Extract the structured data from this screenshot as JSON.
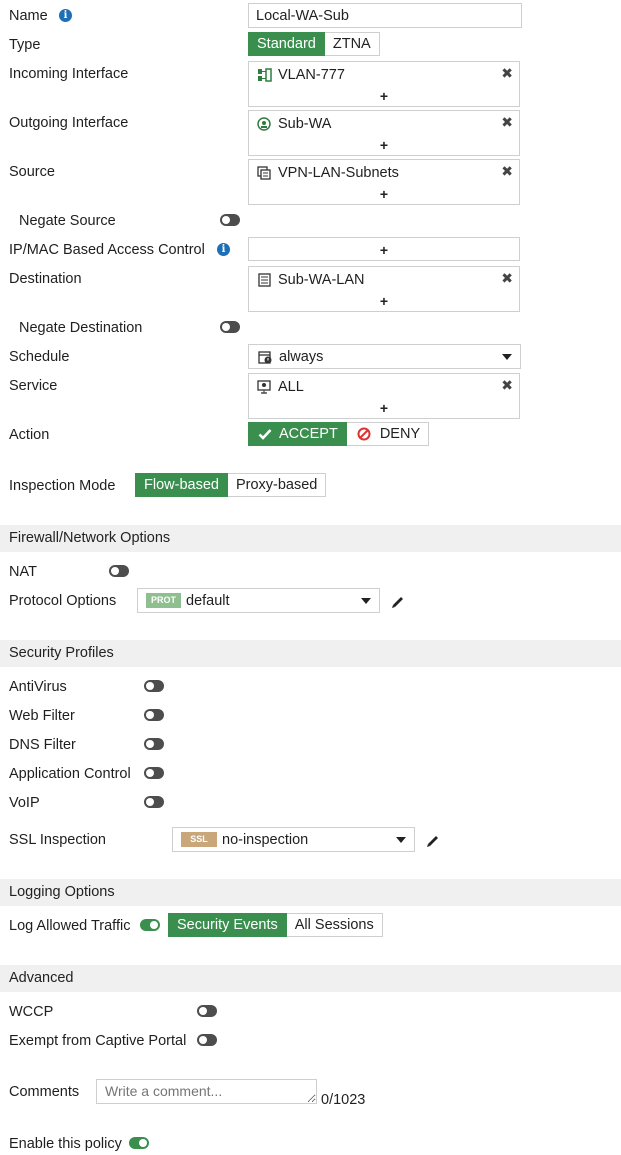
{
  "labels": {
    "name": "Name",
    "type": "Type",
    "incoming_interface": "Incoming Interface",
    "outgoing_interface": "Outgoing Interface",
    "source": "Source",
    "negate_source": "Negate Source",
    "ipmac": "IP/MAC Based Access Control",
    "destination": "Destination",
    "negate_destination": "Negate Destination",
    "schedule": "Schedule",
    "service": "Service",
    "action": "Action",
    "inspection_mode": "Inspection Mode"
  },
  "name_value": "Local-WA-Sub",
  "type_options": [
    "Standard",
    "ZTNA"
  ],
  "incoming_interface": "VLAN-777",
  "outgoing_interface": "Sub-WA",
  "source": "VPN-LAN-Subnets",
  "destination": "Sub-WA-LAN",
  "schedule": "always",
  "service": "ALL",
  "add_symbol": "+",
  "remove_symbol": "✖",
  "action_options": [
    "ACCEPT",
    "DENY"
  ],
  "inspection_options": [
    "Flow-based",
    "Proxy-based"
  ],
  "firewall": {
    "title": "Firewall/Network Options",
    "nat": "NAT",
    "protocol_options": "Protocol Options",
    "prot_tag": "PROT",
    "protocol_value": "default"
  },
  "security": {
    "title": "Security Profiles",
    "antivirus": "AntiVirus",
    "web_filter": "Web Filter",
    "dns_filter": "DNS Filter",
    "app_control": "Application Control",
    "voip": "VoIP",
    "ssl_inspection": "SSL Inspection",
    "ssl_tag": "SSL",
    "ssl_value": "no-inspection"
  },
  "logging": {
    "title": "Logging Options",
    "log_allowed": "Log Allowed Traffic",
    "options": [
      "Security Events",
      "All Sessions"
    ]
  },
  "advanced": {
    "title": "Advanced",
    "wccp": "WCCP",
    "exempt": "Exempt from Captive Portal"
  },
  "comments": {
    "label": "Comments",
    "placeholder": "Write a comment...",
    "counter": "0/1023"
  },
  "enable_policy": "Enable this policy",
  "colors": {
    "accent_green": "#3a8f4f",
    "toggle_off": "#4d4d4d",
    "info_blue": "#1e6fb5",
    "deny_red": "#d33",
    "prot_tag": "#8fbf8f",
    "ssl_tag": "#c9a77a"
  }
}
